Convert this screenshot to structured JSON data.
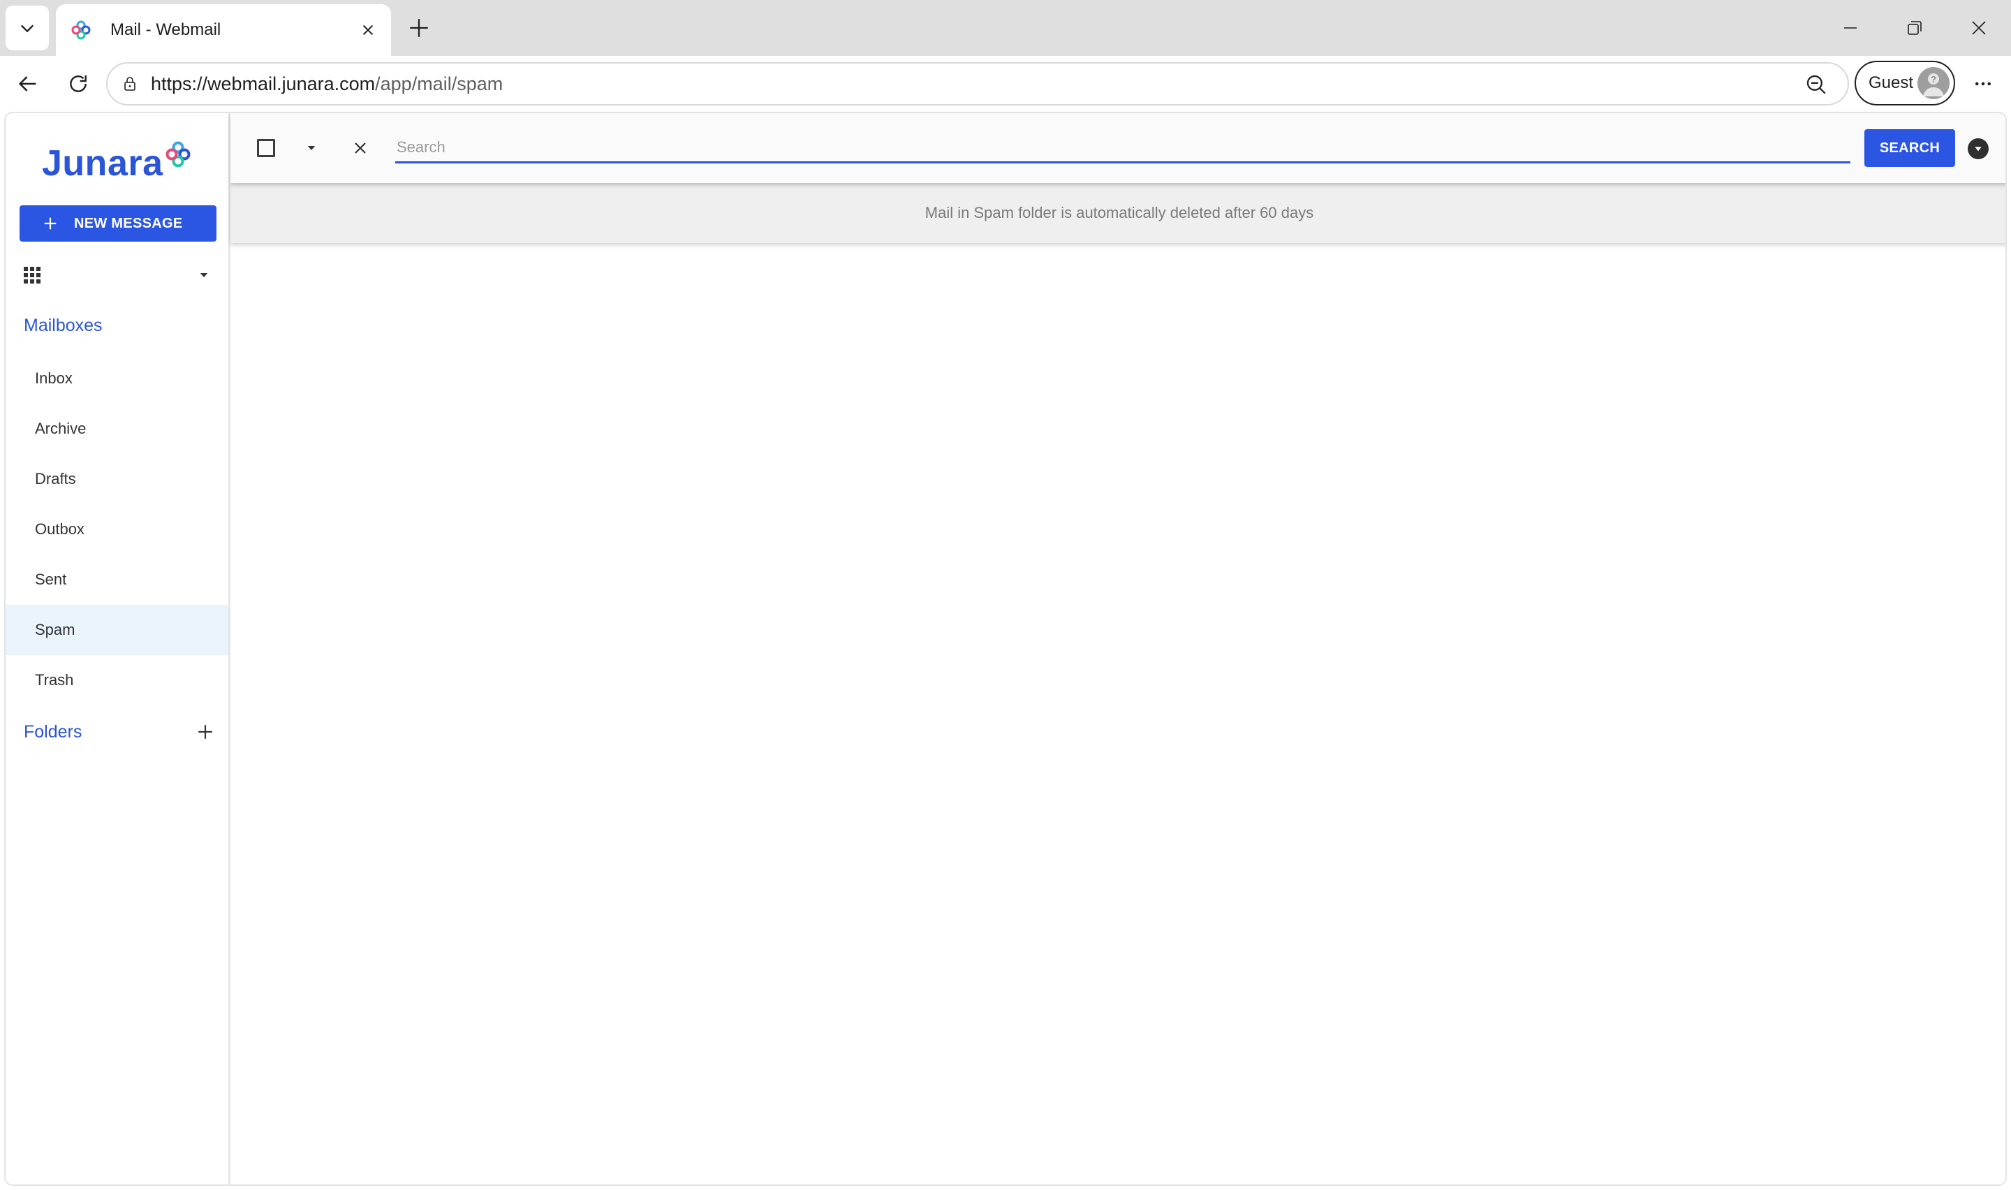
{
  "browser": {
    "tab_title": "Mail - Webmail",
    "url_host": "https://webmail.junara.com",
    "url_path": "/app/mail/spam",
    "profile_label": "Guest"
  },
  "app": {
    "logo_text": "Junara",
    "brand_color": "#2b55d8",
    "accent_color": "#2b55e3",
    "new_message_label": "NEW MESSAGE",
    "mailboxes_title": "Mailboxes",
    "mailboxes": [
      {
        "label": "Inbox",
        "active": false
      },
      {
        "label": "Archive",
        "active": false
      },
      {
        "label": "Drafts",
        "active": false
      },
      {
        "label": "Outbox",
        "active": false
      },
      {
        "label": "Sent",
        "active": false
      },
      {
        "label": "Spam",
        "active": true
      },
      {
        "label": "Trash",
        "active": false
      }
    ],
    "folders_title": "Folders"
  },
  "toolbar": {
    "search_placeholder": "Search",
    "search_value": "",
    "search_button_label": "SEARCH"
  },
  "notice": {
    "text": "Mail in Spam folder is automatically deleted after 60 days"
  },
  "icons": {
    "tab_list": "chevron-down-icon",
    "favicon": "junara-favicon-icon",
    "tab_close": "close-icon",
    "new_tab": "plus-icon",
    "minimize": "minimize-icon",
    "restore": "restore-icon",
    "window_close": "close-icon",
    "back": "arrow-left-icon",
    "reload": "reload-icon",
    "site_info": "lock-icon",
    "zoom": "zoom-out-icon",
    "avatar": "guest-avatar-icon",
    "more": "more-horizontal-icon",
    "apps": "apps-grid-icon",
    "add_folder": "plus-icon",
    "advanced_search": "chevron-down-circle-icon"
  }
}
